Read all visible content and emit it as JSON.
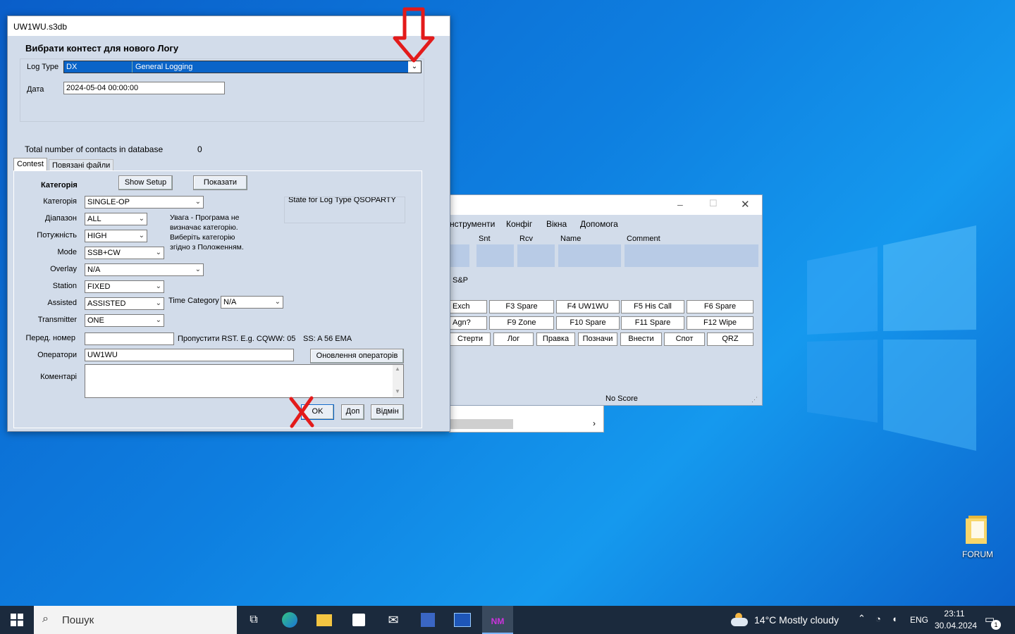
{
  "dialog": {
    "title": "UW1WU.s3db",
    "heading": "Вибрати контест для нового Логу",
    "log_type_label": "Log Type",
    "log_type_value": "DX",
    "log_type_desc": "General Logging",
    "date_label": "Дата",
    "date_value": "2024-05-04 00:00:00",
    "total_label": "Total number of contacts in database",
    "total_value": "0",
    "tabs": [
      "Contest",
      "Повязані файли"
    ],
    "category_heading": "Категорія",
    "show_setup": "Show Setup",
    "show_btn": "Показати",
    "state_label": "State for Log Type QSOPARTY",
    "fields": {
      "category": {
        "label": "Категорія",
        "value": "SINGLE-OP"
      },
      "band": {
        "label": "Діапазон",
        "value": "ALL"
      },
      "power": {
        "label": "Потужність",
        "value": "HIGH"
      },
      "mode": {
        "label": "Mode",
        "value": "SSB+CW"
      },
      "overlay": {
        "label": "Overlay",
        "value": "N/A"
      },
      "station": {
        "label": "Station",
        "value": "FIXED"
      },
      "assisted": {
        "label": "Assisted",
        "value": "ASSISTED"
      },
      "transmitter": {
        "label": "Transmitter",
        "value": "ONE"
      },
      "time_category": {
        "label": "Time Category",
        "value": "N/A"
      }
    },
    "warning": [
      "Увага -  Програма не",
      "визначає категорію.",
      "Виберіть категорію",
      "згідно з Положенням."
    ],
    "sent_label": "Перед. номер",
    "sent_hint": "Пропустити RST. E.g. CQWW: 05",
    "ss_hint": "SS: A 56 EMA",
    "operators_label": "Оператори",
    "operators_value": "UW1WU",
    "update_ops": "Оновлення операторів",
    "comments_label": "Коментарі",
    "ok": "OK",
    "help": "Доп",
    "cancel": "Відмін"
  },
  "main_window": {
    "menu": [
      "нструменти",
      "Конфіг",
      "Вікна",
      "Допомога"
    ],
    "columns": [
      "Snt",
      "Rcv",
      "Name",
      "Comment"
    ],
    "sp": "S&P",
    "row1": [
      "Exch",
      "F3 Spare",
      "F4 UW1WU",
      "F5 His Call",
      "F6 Spare"
    ],
    "row2": [
      "Agn?",
      "F9 Zone",
      "F10 Spare",
      "F11 Spare",
      "F12 Wipe"
    ],
    "row3": [
      "Стерти",
      "Лог",
      "Правка",
      "Позначи",
      "Внести",
      "Спот",
      "QRZ"
    ],
    "score": "No Score"
  },
  "desktop": {
    "folder_label": "FORUM"
  },
  "taskbar": {
    "search_placeholder": "Пошук",
    "weather": "14°C  Mostly cloudy",
    "lang": "ENG",
    "time": "23:11",
    "date": "30.04.2024",
    "notif_count": "1"
  },
  "colors": {
    "annotation": "#e31b1b",
    "selected": "#0a64c8"
  }
}
